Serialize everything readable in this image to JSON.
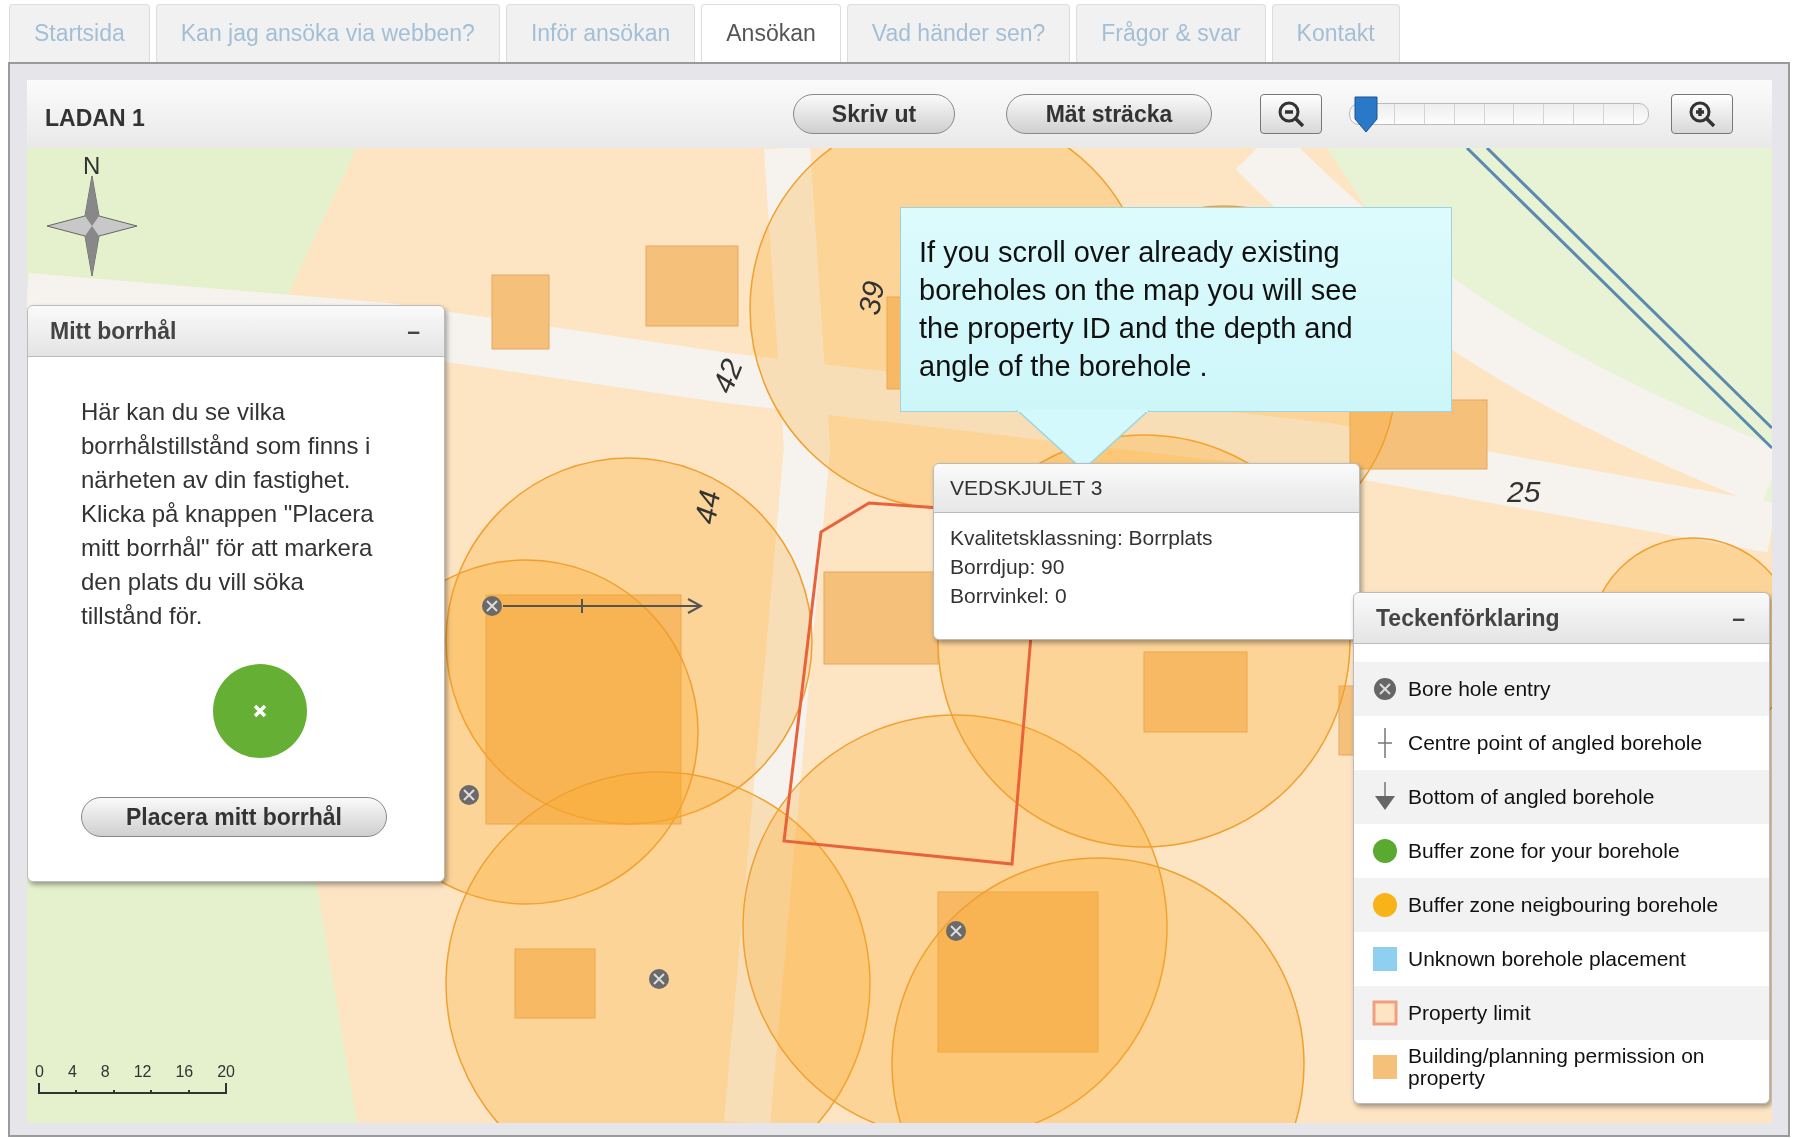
{
  "tabs": [
    {
      "label": "Startsida",
      "selected": false
    },
    {
      "label": "Kan jag ansöka via webben?",
      "selected": false
    },
    {
      "label": "Inför ansökan",
      "selected": false
    },
    {
      "label": "Ansökan",
      "selected": true
    },
    {
      "label": "Vad händer sen?",
      "selected": false
    },
    {
      "label": "Frågor & svar",
      "selected": false
    },
    {
      "label": "Kontakt",
      "selected": false
    }
  ],
  "toolbar": {
    "title": "LADAN 1",
    "buttons": [
      "Skriv ut",
      "Mät sträcka"
    ],
    "zoom_slider": {
      "level": 0.02
    }
  },
  "map": {
    "compass_label": "N",
    "street_numbers": [
      {
        "label": "39",
        "kind": "vertical"
      },
      {
        "label": "42",
        "kind": "tilted"
      },
      {
        "label": "44",
        "kind": "vertical"
      },
      {
        "label": "25",
        "kind": "flat"
      }
    ],
    "scale_ticks": [
      "0",
      "4",
      "8",
      "12",
      "16",
      "20"
    ]
  },
  "my_borehole_panel": {
    "title": "Mitt borrhål",
    "collapse": "–",
    "text": "Här kan du se vilka borrhålstillstånd som finns i närheten av din fastighet. Klicka på knappen \"Placera mitt borrhål\" för att markera den plats du vill söka tillstånd för.",
    "button": "Placera mitt borrhål"
  },
  "callout": {
    "text": "If you scroll over already existing boreholes on the map you will see the property ID and the depth and angle of the borehole ."
  },
  "popup": {
    "title": "VEDSKJULET 3",
    "lines": [
      "Kvalitetsklassning: Borrplats",
      "Borrdjup: 90",
      "Borrvinkel: 0"
    ]
  },
  "legend": {
    "title": "Teckenförklaring",
    "collapse": "–",
    "items": [
      {
        "kind": "entry",
        "label": "Bore hole entry"
      },
      {
        "kind": "centre",
        "label": "Centre point of angled borehole"
      },
      {
        "kind": "bottom",
        "label": "Bottom of angled borehole"
      },
      {
        "kind": "dot",
        "color": "#5aaa32",
        "label": "Buffer zone for your borehole"
      },
      {
        "kind": "dot",
        "color": "#f8b319",
        "label": "Buffer zone neigbouring borehole"
      },
      {
        "kind": "square",
        "color": "#8fd0f0",
        "label": "Unknown borehole placement"
      },
      {
        "kind": "outline",
        "color": "#f0a080",
        "label": "Property limit"
      },
      {
        "kind": "square",
        "color": "#f5c07a",
        "label": "Building/planning permission on property"
      }
    ]
  }
}
